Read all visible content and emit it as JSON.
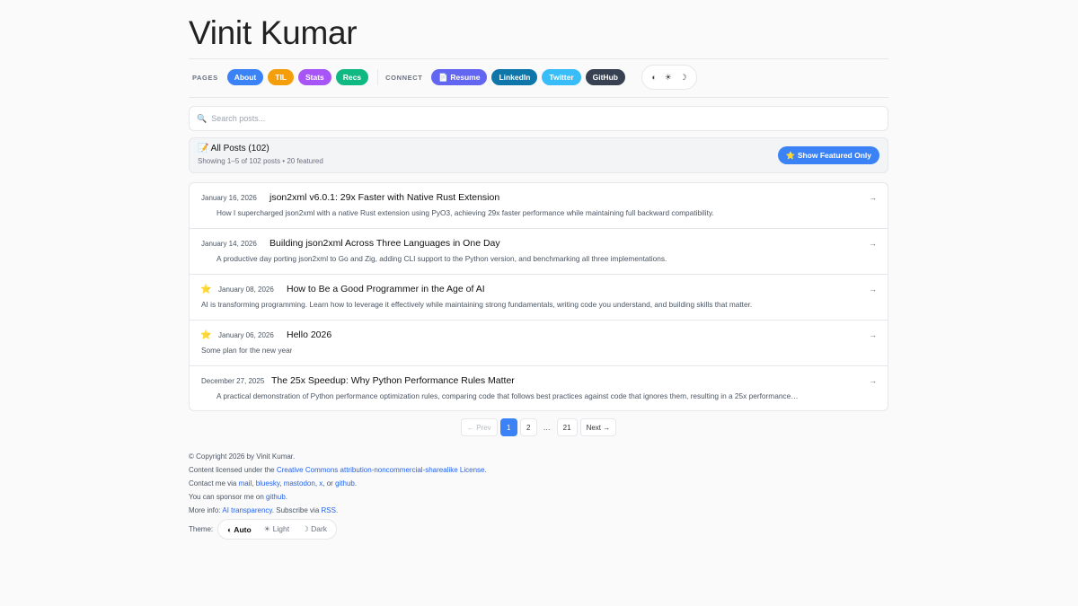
{
  "site": {
    "title": "Vinit Kumar"
  },
  "nav": {
    "pages_label": "PAGES",
    "pages": [
      {
        "label": "About",
        "color": "#3b82f6"
      },
      {
        "label": "TIL",
        "color": "#f59e0b"
      },
      {
        "label": "Stats",
        "color": "#a855f7"
      },
      {
        "label": "Recs",
        "color": "#10b981"
      }
    ],
    "connect_label": "CONNECT",
    "connect": [
      {
        "label": "📄 Resume",
        "color": "#6366f1"
      },
      {
        "label": "LinkedIn",
        "color": "#0e76a8"
      },
      {
        "label": "Twitter",
        "color": "#38bdf8"
      },
      {
        "label": "GitHub",
        "color": "#374151"
      }
    ],
    "theme_icons": [
      "◐",
      "☀",
      "☽"
    ]
  },
  "search": {
    "icon": "🔍",
    "placeholder": "Search posts..."
  },
  "posts_header": {
    "title": "📝 All Posts (102)",
    "subtitle": "Showing 1–5 of 102 posts • 20 featured",
    "featured_button": "⭐ Show Featured Only",
    "accent": "#3b82f6"
  },
  "posts": [
    {
      "date": "January 16, 2026",
      "featured": false,
      "title": "json2xml v6.0.1: 29x Faster with Native Rust Extension",
      "desc": "How I supercharged json2xml with a native Rust extension using PyO3, achieving 29x faster performance while maintaining full backward compatibility.",
      "arrow": "→"
    },
    {
      "date": "January 14, 2026",
      "featured": false,
      "title": "Building json2xml Across Three Languages in One Day",
      "desc": "A productive day porting json2xml to Go and Zig, adding CLI support to the Python version, and benchmarking all three implementations.",
      "arrow": "→"
    },
    {
      "date": "January 08, 2026",
      "featured": true,
      "title": "How to Be a Good Programmer in the Age of AI",
      "desc": "AI is transforming programming. Learn how to leverage it effectively while maintaining strong fundamentals, writing code you understand, and building skills that matter.",
      "arrow": "→"
    },
    {
      "date": "January 06, 2026",
      "featured": true,
      "title": "Hello 2026",
      "desc": "Some plan for the new year",
      "arrow": "→"
    },
    {
      "date": "December 27, 2025",
      "featured": false,
      "title": "The 25x Speedup: Why Python Performance Rules Matter",
      "desc": "A practical demonstration of Python performance optimization rules, comparing code that follows best practices against code that ignores them, resulting in a 25x performance…",
      "arrow": "→"
    }
  ],
  "pagination": {
    "prev": "← Prev",
    "pages": [
      "1",
      "2"
    ],
    "dots": "…",
    "last": "21",
    "next": "Next →",
    "current": "1"
  },
  "footer": {
    "copyright": "© Copyright 2026 by Vinit Kumar.",
    "license_prefix": "Content licensed under the ",
    "license_link": "Creative Commons attribution-noncommercial-sharealike License",
    "license_suffix": ".",
    "contact_prefix": "Contact me via ",
    "contact_mail": "mail",
    "contact_bluesky": "bluesky",
    "contact_mastodon": "mastodon",
    "contact_x": "x",
    "contact_or": ", or ",
    "contact_github": "github",
    "sponsor_prefix": "You can sponsor me on ",
    "sponsor_link": "github",
    "more_prefix": "More info: ",
    "ai_link": "AI transparency",
    "subscribe_text": ". Subscribe via ",
    "rss_link": "RSS",
    "theme_label": "Theme:",
    "theme_options": [
      "◐ Auto",
      "☀ Light",
      "☽ Dark"
    ],
    "theme_selected": "◐ Auto"
  }
}
